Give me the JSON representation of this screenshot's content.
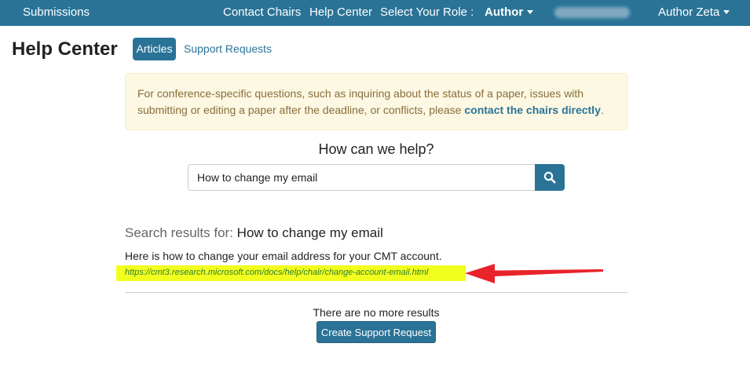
{
  "navbar": {
    "submissions": "Submissions",
    "contact_chairs": "Contact Chairs",
    "help_center": "Help Center",
    "role_label": "Select Your Role :",
    "role_value": "Author",
    "user_menu": "Author Zeta"
  },
  "page": {
    "title": "Help Center",
    "tabs": [
      {
        "label": "Articles",
        "active": true
      },
      {
        "label": "Support Requests",
        "active": false
      }
    ]
  },
  "alert": {
    "text": "For conference-specific questions, such as inquiring about the status of a paper, issues with submitting or editing a paper after the deadline, or conflicts, please ",
    "link": "contact the chairs directly",
    "suffix": "."
  },
  "search": {
    "heading": "How can we help?",
    "value": "How to change my email",
    "button_icon": "search-icon"
  },
  "results": {
    "prefix": "Search results for: ",
    "query": "How to change my email",
    "items": [
      {
        "description": "Here is how to change your email address for your CMT account.",
        "url": "https://cmt3.research.microsoft.com/docs/help/chair/change-account-email.html"
      }
    ],
    "no_more": "There are no more results",
    "support_button": "Create Support Request"
  },
  "colors": {
    "brand": "#2a7397",
    "alert_bg": "#fcf8e3",
    "highlight": "#f2ff1e",
    "annotation_arrow": "#e8242a"
  }
}
